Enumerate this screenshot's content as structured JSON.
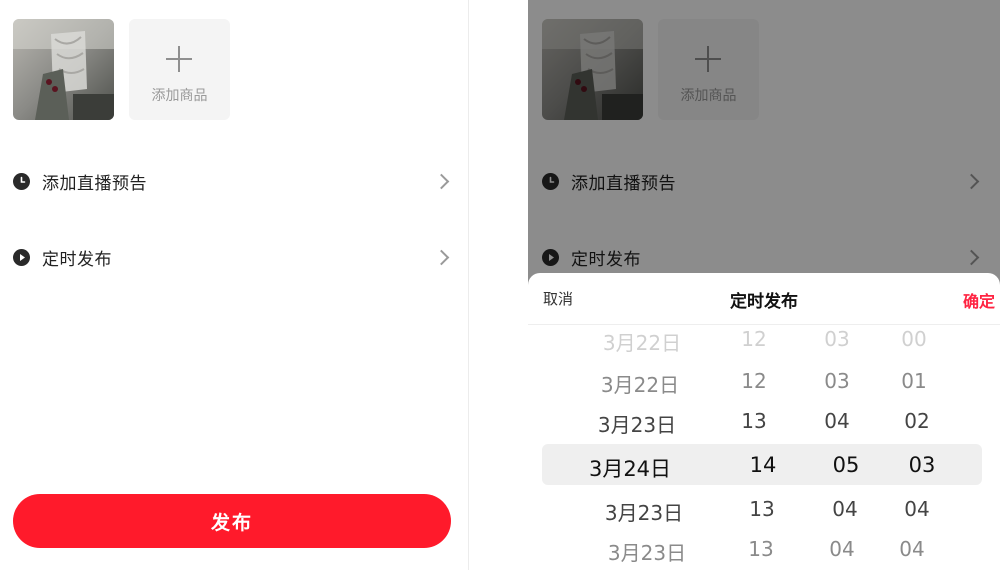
{
  "left": {
    "add_product_label": "添加商品",
    "rows": [
      {
        "label": "添加直播预告",
        "icon": "clock-icon"
      },
      {
        "label": "定时发布",
        "icon": "play-circle-icon"
      }
    ],
    "publish_label": "发布"
  },
  "right": {
    "add_product_label": "添加商品",
    "rows": [
      {
        "label": "添加直播预告",
        "icon": "clock-icon"
      },
      {
        "label": "定时发布",
        "icon": "play-circle-icon"
      }
    ],
    "sheet": {
      "cancel_label": "取消",
      "title": "定时发布",
      "confirm_label": "确定"
    },
    "picker": {
      "rows": [
        [
          "3月22日",
          "12",
          "03",
          "00"
        ],
        [
          "3月22日",
          "12",
          "03",
          "01"
        ],
        [
          "3月23日",
          "13",
          "04",
          "02"
        ],
        [
          "3月24日",
          "14",
          "05",
          "03"
        ],
        [
          "3月23日",
          "13",
          "04",
          "04"
        ],
        [
          "3月23日",
          "13",
          "04",
          "04"
        ]
      ],
      "selected_index": 3
    }
  },
  "colors": {
    "accent": "#ff1a2b",
    "confirm": "#ff2442"
  }
}
